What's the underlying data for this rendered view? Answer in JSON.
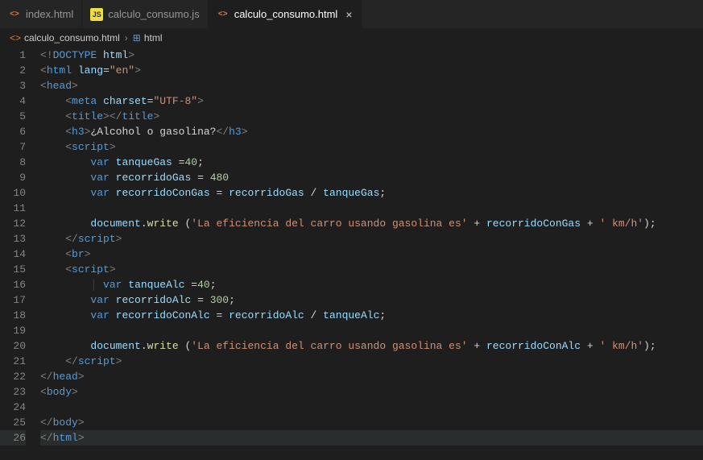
{
  "tabs": [
    {
      "label": "index.html",
      "icon": "<>",
      "active": false
    },
    {
      "label": "calculo_consumo.js",
      "icon": "JS",
      "active": false
    },
    {
      "label": "calculo_consumo.html",
      "icon": "<>",
      "active": true
    }
  ],
  "breadcrumb": {
    "file": "calculo_consumo.html",
    "symbol": "html"
  },
  "code": {
    "lines": [
      {
        "n": 1,
        "indent": 0,
        "html": "<span class='t-punct'>&lt;!</span><span class='t-doctype'>DOCTYPE</span> <span class='t-attr'>html</span><span class='t-punct'>&gt;</span>"
      },
      {
        "n": 2,
        "indent": 0,
        "html": "<span class='t-punct'>&lt;</span><span class='t-tag'>html</span> <span class='t-attr'>lang</span><span class='t-text'>=</span><span class='t-string'>\"en\"</span><span class='t-punct'>&gt;</span>"
      },
      {
        "n": 3,
        "indent": 0,
        "html": "<span class='t-punct'>&lt;</span><span class='t-tag'>head</span><span class='t-punct'>&gt;</span>"
      },
      {
        "n": 4,
        "indent": 1,
        "html": "<span class='t-punct'>&lt;</span><span class='t-tag'>meta</span> <span class='t-attr'>charset</span><span class='t-text'>=</span><span class='t-string'>\"UTF-8\"</span><span class='t-punct'>&gt;</span>"
      },
      {
        "n": 5,
        "indent": 1,
        "html": "<span class='t-punct'>&lt;</span><span class='t-tag'>title</span><span class='t-punct'>&gt;&lt;/</span><span class='t-tag'>title</span><span class='t-punct'>&gt;</span>"
      },
      {
        "n": 6,
        "indent": 1,
        "html": "<span class='t-punct'>&lt;</span><span class='t-tag'>h3</span><span class='t-punct'>&gt;</span><span class='t-text'>¿Alcohol o gasolina?</span><span class='t-punct'>&lt;/</span><span class='t-tag'>h3</span><span class='t-punct'>&gt;</span>"
      },
      {
        "n": 7,
        "indent": 1,
        "html": "<span class='t-punct'>&lt;</span><span class='t-tag'>script</span><span class='t-punct'>&gt;</span>"
      },
      {
        "n": 8,
        "indent": 2,
        "html": "<span class='t-keyword'>var</span> <span class='t-var'>tanqueGas</span> <span class='t-op'>=</span><span class='t-num'>40</span><span class='t-text'>;</span>"
      },
      {
        "n": 9,
        "indent": 2,
        "html": "<span class='t-keyword'>var</span> <span class='t-var'>recorridoGas</span> <span class='t-op'>=</span> <span class='t-num'>480</span>"
      },
      {
        "n": 10,
        "indent": 2,
        "html": "<span class='t-keyword'>var</span> <span class='t-var'>recorridoConGas</span> <span class='t-op'>=</span> <span class='t-var'>recorridoGas</span> <span class='t-op'>/</span> <span class='t-var'>tanqueGas</span><span class='t-text'>;</span>"
      },
      {
        "n": 11,
        "indent": 0,
        "html": ""
      },
      {
        "n": 12,
        "indent": 2,
        "html": "<span class='t-obj'>document</span><span class='t-text'>.</span><span class='t-func'>write</span> <span class='t-text'>(</span><span class='t-string'>'La eficiencia del carro usando gasolina es'</span> <span class='t-op'>+</span> <span class='t-var'>recorridoConGas</span> <span class='t-op'>+</span> <span class='t-string'>' km/h'</span><span class='t-text'>);</span>"
      },
      {
        "n": 13,
        "indent": 1,
        "html": "<span class='t-punct'>&lt;/</span><span class='t-tag'>script</span><span class='t-punct'>&gt;</span>"
      },
      {
        "n": 14,
        "indent": 1,
        "html": "<span class='t-punct'>&lt;</span><span class='t-tag'>br</span><span class='t-punct'>&gt;</span>"
      },
      {
        "n": 15,
        "indent": 1,
        "html": "<span class='t-punct'>&lt;</span><span class='t-tag'>script</span><span class='t-punct'>&gt;</span>"
      },
      {
        "n": 16,
        "indent": 2,
        "html": "<span class='guide'>│</span> <span class='t-keyword'>var</span> <span class='t-var'>tanqueAlc</span> <span class='t-op'>=</span><span class='t-num'>40</span><span class='t-text'>;</span>"
      },
      {
        "n": 17,
        "indent": 2,
        "html": "<span class='t-keyword'>var</span> <span class='t-var'>recorridoAlc</span> <span class='t-op'>=</span> <span class='t-num'>300</span><span class='t-text'>;</span>"
      },
      {
        "n": 18,
        "indent": 2,
        "html": "<span class='t-keyword'>var</span> <span class='t-var'>recorridoConAlc</span> <span class='t-op'>=</span> <span class='t-var'>recorridoAlc</span> <span class='t-op'>/</span> <span class='t-var'>tanqueAlc</span><span class='t-text'>;</span>"
      },
      {
        "n": 19,
        "indent": 0,
        "html": ""
      },
      {
        "n": 20,
        "indent": 2,
        "html": "<span class='t-obj'>document</span><span class='t-text'>.</span><span class='t-func'>write</span> <span class='t-text'>(</span><span class='t-string'>'La eficiencia del carro usando gasolina es'</span> <span class='t-op'>+</span> <span class='t-var'>recorridoConAlc</span> <span class='t-op'>+</span> <span class='t-string'>' km/h'</span><span class='t-text'>);</span>"
      },
      {
        "n": 21,
        "indent": 1,
        "html": "<span class='t-punct'>&lt;/</span><span class='t-tag'>script</span><span class='t-punct'>&gt;</span>"
      },
      {
        "n": 22,
        "indent": 0,
        "html": "<span class='t-punct'>&lt;/</span><span class='t-tag'>head</span><span class='t-punct'>&gt;</span>"
      },
      {
        "n": 23,
        "indent": 0,
        "html": "<span class='t-punct'>&lt;</span><span class='t-tag'>body</span><span class='t-punct'>&gt;</span>"
      },
      {
        "n": 24,
        "indent": 0,
        "html": ""
      },
      {
        "n": 25,
        "indent": 0,
        "html": "<span class='t-punct'>&lt;/</span><span class='t-tag'>body</span><span class='t-punct'>&gt;</span>"
      },
      {
        "n": 26,
        "indent": 0,
        "hl": true,
        "html": "<span class='t-punct'>&lt;/</span><span class='t-tag'>html</span><span class='t-punct'>&gt;</span>"
      }
    ]
  }
}
